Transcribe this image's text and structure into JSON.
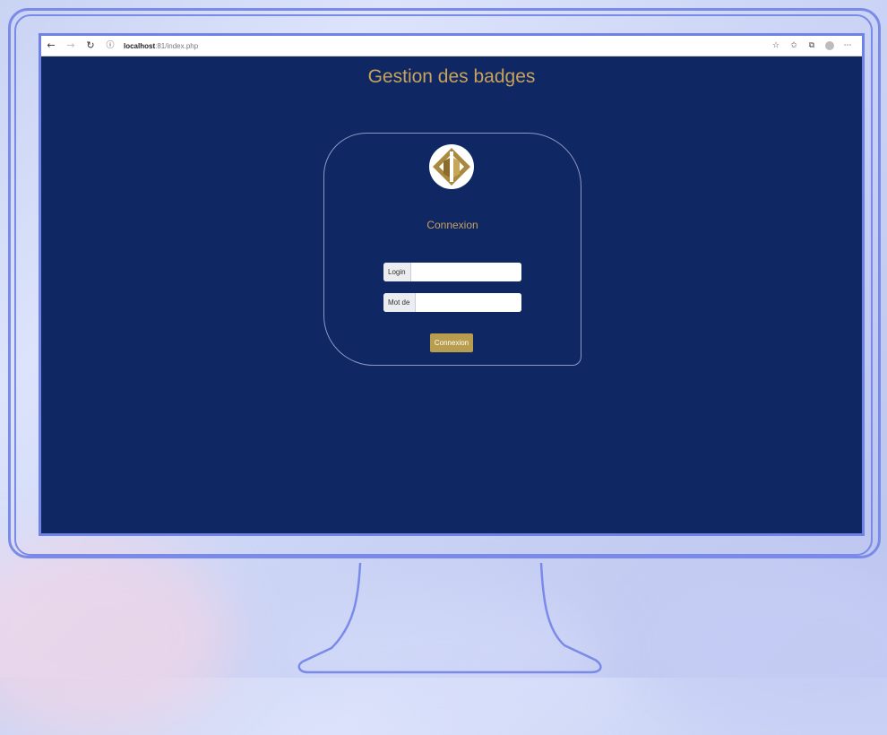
{
  "browser": {
    "url_host": "localhost",
    "url_rest": ":81/index.php",
    "back_icon": "arrow-left-icon",
    "forward_icon": "arrow-right-icon",
    "reload_icon": "reload-icon",
    "info_icon": "info-icon"
  },
  "page": {
    "title": "Gestion des badges"
  },
  "login_card": {
    "heading": "Connexion",
    "login_label": "Login",
    "login_value": "",
    "password_label": "Mot de passe",
    "password_value": "",
    "submit_label": "Connexion"
  },
  "colors": {
    "background": "#0f2762",
    "accent_gold": "#c8a25a",
    "button_gold": "#b89d4e"
  }
}
